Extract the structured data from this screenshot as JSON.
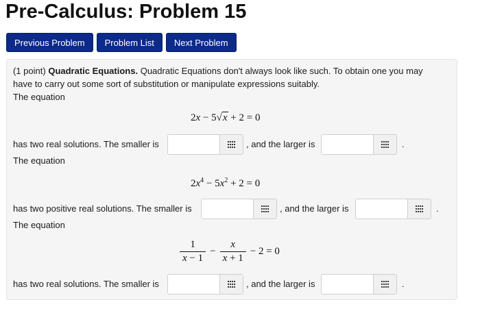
{
  "page": {
    "title": "Pre-Calculus: Problem 15"
  },
  "nav": {
    "previous": "Previous Problem",
    "list": "Problem List",
    "next": "Next Problem"
  },
  "problem": {
    "points": "(1 point)",
    "topic": "Quadratic Equations.",
    "intro_line1": "Quadratic Equations don't always look like such. To obtain one you may",
    "intro_line2": "have to carry out some sort of substitution or manipulate expressions suitably.",
    "parts": [
      {
        "lead": "The equation",
        "prompt": "has two real solutions. The smaller is",
        "larger_label": ", and the larger is",
        "smaller_value": "",
        "larger_value": ""
      },
      {
        "lead": "The equation",
        "prompt": "has two positive real solutions. The smaller is",
        "larger_label": ", and the larger is",
        "smaller_value": "",
        "larger_value": ""
      },
      {
        "lead": "The equation",
        "prompt": "has two real solutions. The smaller is",
        "larger_label": ", and the larger is",
        "smaller_value": "",
        "larger_value": ""
      }
    ],
    "period": "."
  },
  "icons": {
    "equation_editor": "grid-keypad-icon"
  },
  "colors": {
    "nav_button": "#0b2a8a",
    "panel_bg": "#f5f5f5"
  }
}
